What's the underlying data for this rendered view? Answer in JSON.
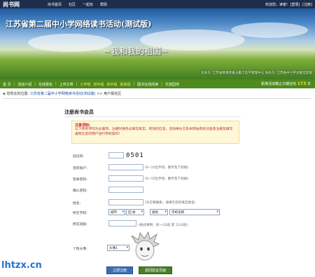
{
  "topbar": {
    "logo": "尚书网",
    "nav": [
      "尚书首页",
      "社区",
      "一起玩",
      "帮助"
    ],
    "welcome": "欢迎您，读者!",
    "login": "[登录]",
    "register": "[注册]"
  },
  "banner": {
    "title": "江苏省第二届中小学网络读书活动(测试版)",
    "subtitle": "~我和我的祖国~",
    "organizer": "主办方: 江苏省教育装备与勤工俭学管理中心  协办方: 江苏省中小学文献信息资"
  },
  "mainnav": {
    "items": [
      "首 页",
      "活动介绍",
      "在线报名",
      "上传文章",
      "小学组",
      "初中组",
      "高中组",
      "职高组",
      "图书在线阅读",
      "交流园地"
    ],
    "countdown_label": "距离活动截止日期还有",
    "countdown_days": "173",
    "countdown_unit": "天"
  },
  "breadcrumb": {
    "prefix": "您现在的位置:",
    "link": "江苏省第二届中小学网络读书活动(测试版)",
    "sep": ">>",
    "current": "用户报名区"
  },
  "form": {
    "title": "注册尚书会员",
    "notice_title": "注意须知:",
    "notice_body": "以下所有项均为必填项，注册时请务必填写真实、有效的信息，活动举办方及本网站有权对恶意注册及填写虚假信息的用户进行停权操作！",
    "captcha_label": "验证码:",
    "captcha_value": "0501",
    "account_label": "您的账户:",
    "account_hint": "(6~15位字母、数字及下划线)",
    "password_label": "登录密码:",
    "password_hint": "(6~15位字母、数字及下划线)",
    "confirm_label": "确认密码:",
    "name_label": "姓名:",
    "name_hint": "(为方便联系，请填写您的真实姓名)",
    "school_label": "所在学校:",
    "city": "城市",
    "district": "区/县",
    "category": "类别",
    "school": "学校名称",
    "class_label": "所在班级:",
    "class_hint": "(格式举例：初一(3)班 或 三(4)班)",
    "avatar_label": "个性头像:",
    "avatar_value": "头像1",
    "submit": "立即注册",
    "back": "返回验证页面"
  },
  "watermark": "lhtzx.cn"
}
